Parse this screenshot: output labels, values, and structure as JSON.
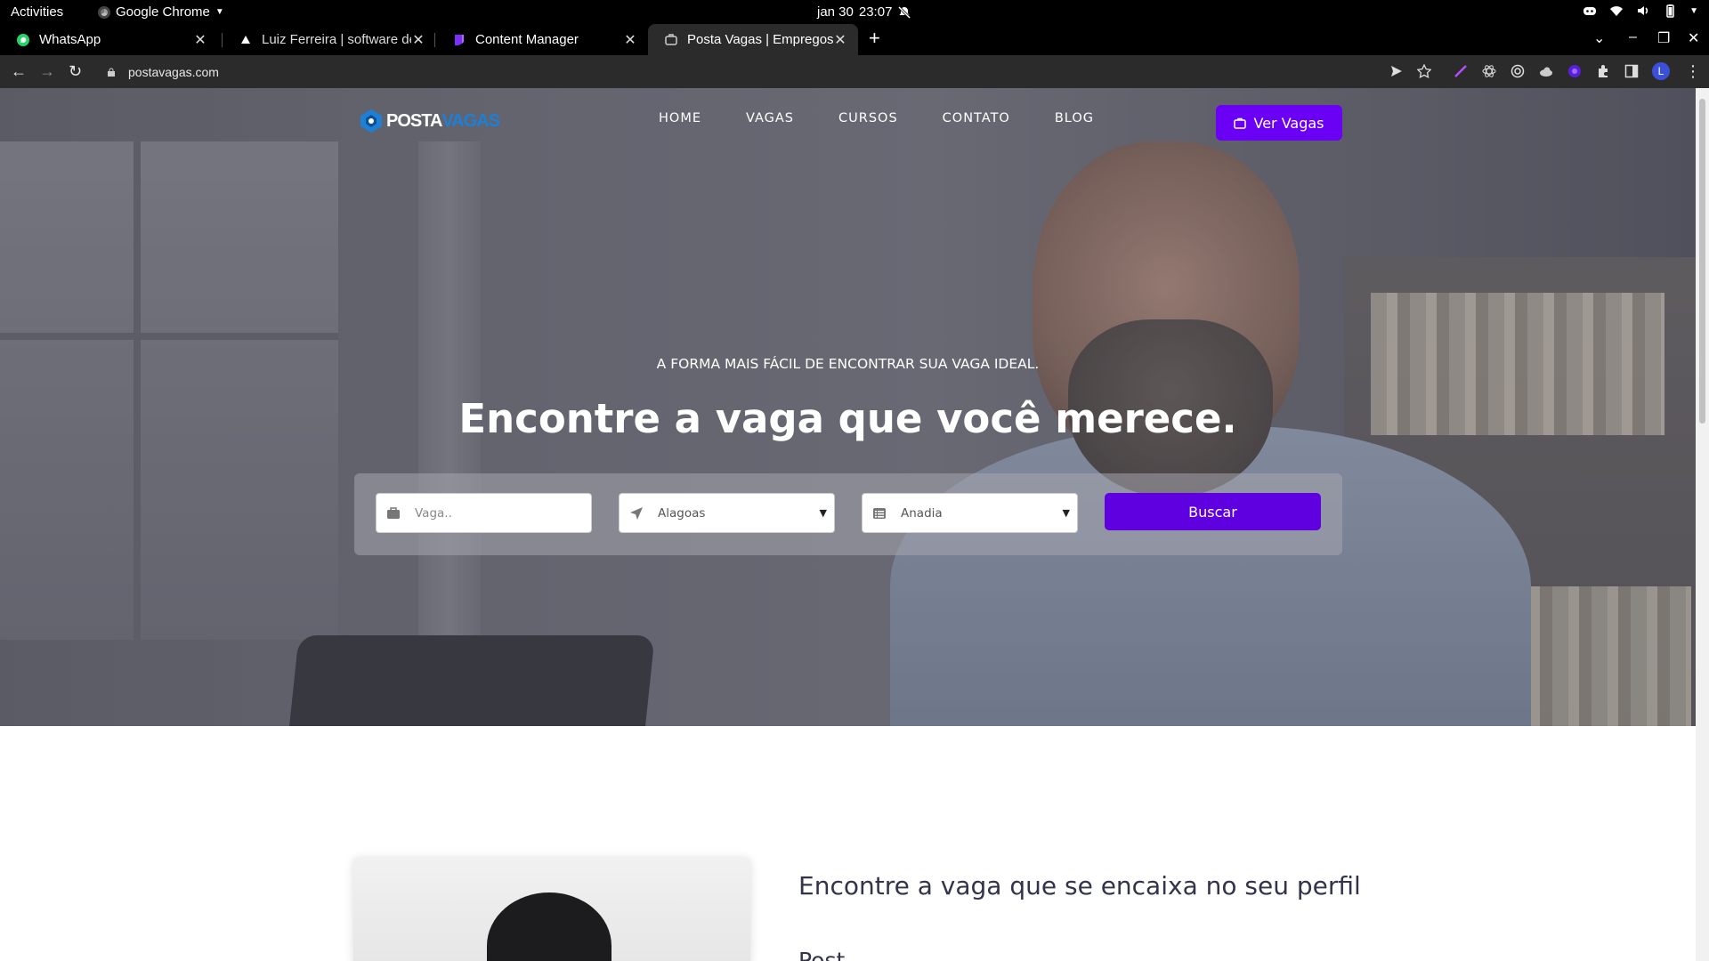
{
  "system_bar": {
    "activities": "Activities",
    "app_name": "Google Chrome",
    "date": "jan 30",
    "time": "23:07"
  },
  "browser": {
    "tabs": [
      {
        "title": "WhatsApp",
        "favicon": "whatsapp-icon"
      },
      {
        "title": "Luiz Ferreira | software de",
        "favicon": "triangle-icon"
      },
      {
        "title": "Content Manager",
        "favicon": "content-manager-icon"
      },
      {
        "title": "Posta Vagas | Empregos E",
        "favicon": "page-icon",
        "active": true
      }
    ],
    "url": "postavagas.com",
    "avatar_letter": "L"
  },
  "site": {
    "logo_part1": "POSTA",
    "logo_part2": "VAGAS",
    "nav": [
      "HOME",
      "VAGAS",
      "CURSOS",
      "CONTATO",
      "BLOG"
    ],
    "cta_label": "Ver Vagas",
    "hero_kicker": "A FORMA MAIS FÁCIL DE ENCONTRAR SUA VAGA IDEAL.",
    "hero_title": "Encontre a vaga que você merece.",
    "search": {
      "job_placeholder": "Vaga..",
      "state_value": "Alagoas",
      "city_value": "Anadia",
      "button_label": "Buscar"
    },
    "section_title": "Encontre a vaga que se encaixa no seu perfil",
    "section_text_partial": "Post                                 á  l          i   l  t      é  l  P  t"
  },
  "colors": {
    "accent": "#6a00f4",
    "search_button": "#5f00e0",
    "logo_blue": "#1d7fd6"
  }
}
